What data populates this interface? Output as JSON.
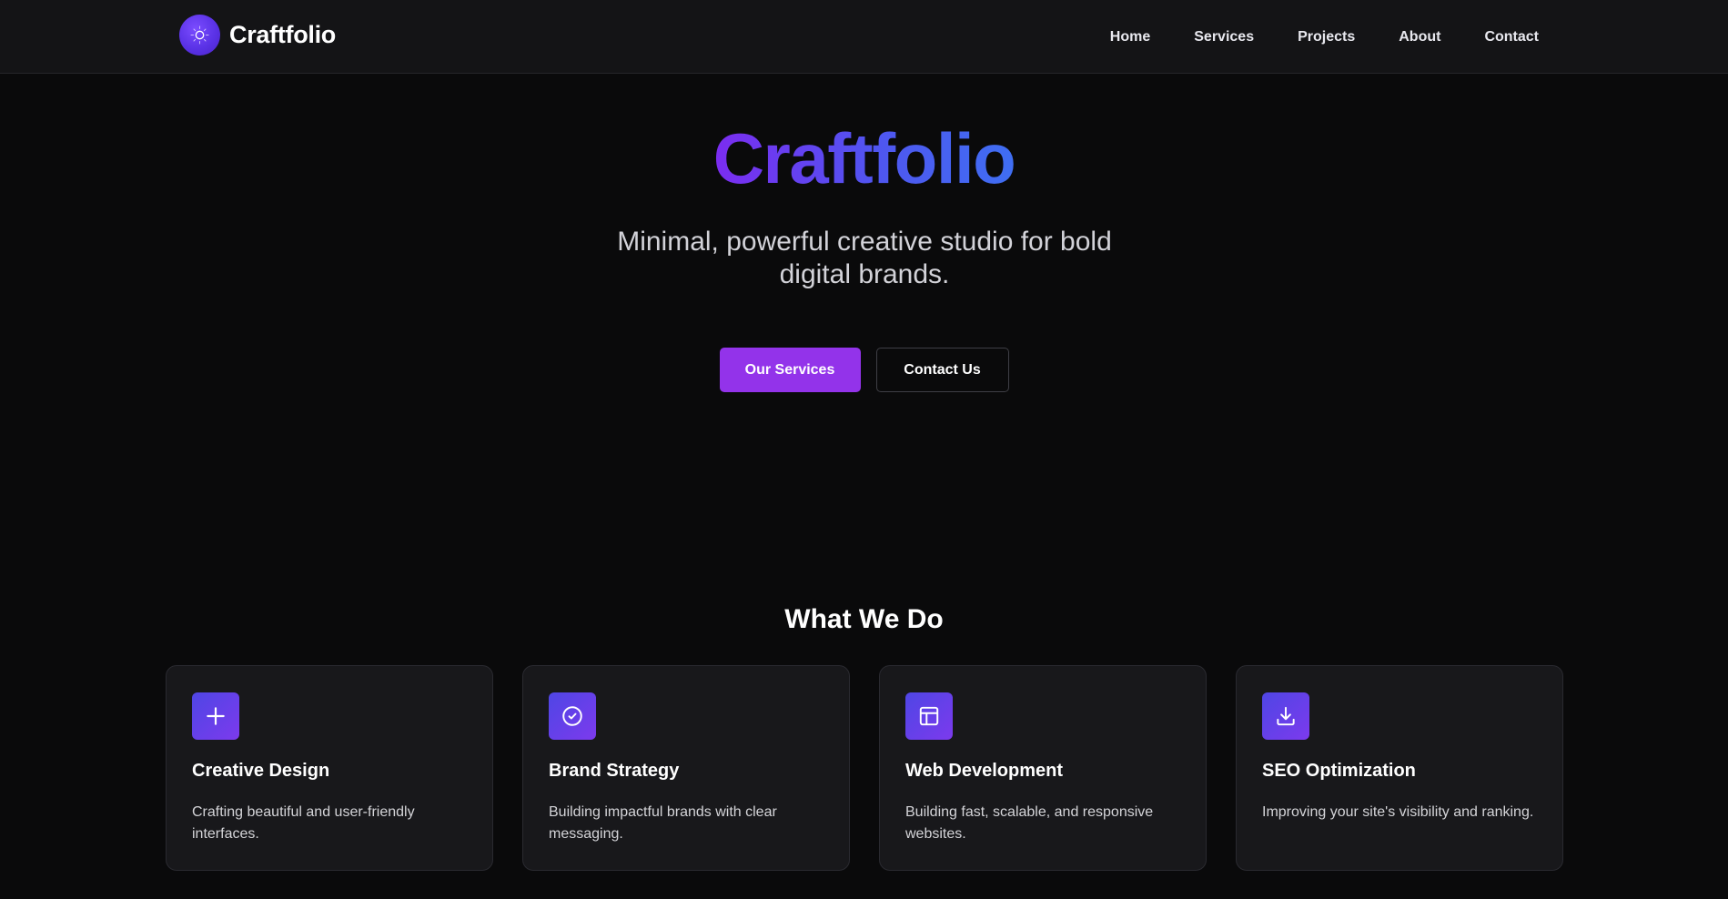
{
  "nav": {
    "brand": "Craftfolio",
    "brand_icon": "sparkle-logo-icon",
    "links": [
      {
        "label": "Home"
      },
      {
        "label": "Services"
      },
      {
        "label": "Projects"
      },
      {
        "label": "About"
      },
      {
        "label": "Contact"
      }
    ]
  },
  "hero": {
    "title": "Craftfolio",
    "subtitle": "Minimal, powerful creative studio for bold digital brands.",
    "primary_button": "Our Services",
    "secondary_button": "Contact Us"
  },
  "services": {
    "title": "What We Do",
    "items": [
      {
        "icon": "plus-icon",
        "title": "Creative Design",
        "desc": "Crafting beautiful and user-friendly interfaces."
      },
      {
        "icon": "check-circle-icon",
        "title": "Brand Strategy",
        "desc": "Building impactful brands with clear messaging."
      },
      {
        "icon": "layout-icon",
        "title": "Web Development",
        "desc": "Building fast, scalable, and responsive websites."
      },
      {
        "icon": "download-icon",
        "title": "SEO Optimization",
        "desc": "Improving your site's visibility and ranking."
      }
    ]
  },
  "colors": {
    "background": "#0a0a0b",
    "navbar": "#141416",
    "accent": "#9333ea",
    "card": "#18181b",
    "gradient_start": "#7b2cf0",
    "gradient_end": "#3f6ef2"
  }
}
